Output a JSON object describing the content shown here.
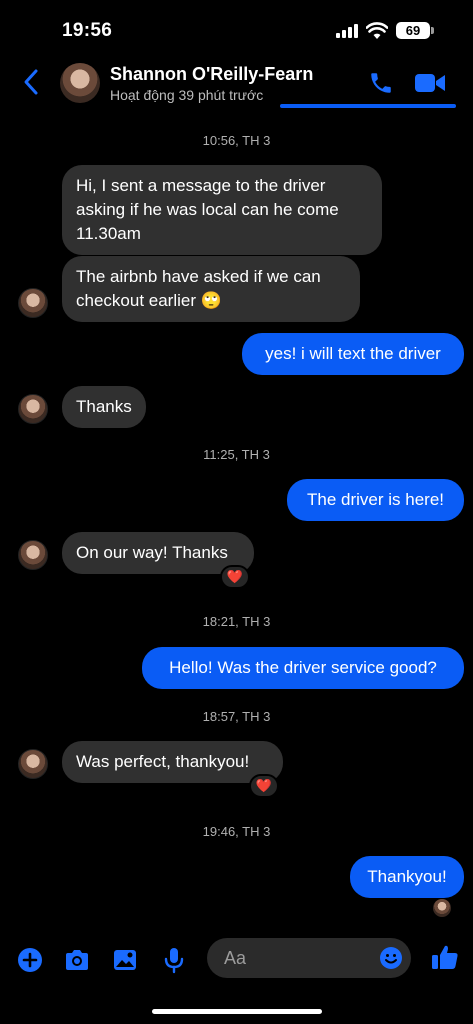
{
  "status": {
    "time": "19:56",
    "battery": "69"
  },
  "header": {
    "name": "Shannon O'Reilly-Fearn",
    "activity": "Hoạt động 39 phút trước"
  },
  "messages": {
    "ts1": "10:56, TH 3",
    "m1": "Hi, I sent a message to the driver asking if he was local can he come 11.30am",
    "m2": "The airbnb have asked if we can checkout earlier 🙄",
    "m3": "yes! i will text the driver",
    "m4": "Thanks",
    "ts2": "11:25, TH 3",
    "m5": "The driver is here!",
    "m6": "On our way! Thanks",
    "r6": "❤️",
    "ts3": "18:21, TH 3",
    "m7": "Hello! Was the driver service good?",
    "ts4": "18:57, TH 3",
    "m8": "Was perfect, thankyou!",
    "r8": "❤️",
    "ts5": "19:46, TH 3",
    "m9": "Thankyou!"
  },
  "composer": {
    "placeholder": "Aa"
  },
  "colors": {
    "accent": "#0a5cf5",
    "incoming_bubble": "#303030",
    "background": "#000000"
  },
  "icons": [
    "back-chevron-icon",
    "phone-icon",
    "video-camera-icon",
    "plus-icon",
    "camera-icon",
    "image-icon",
    "microphone-icon",
    "emoji-icon",
    "thumbs-up-icon"
  ]
}
